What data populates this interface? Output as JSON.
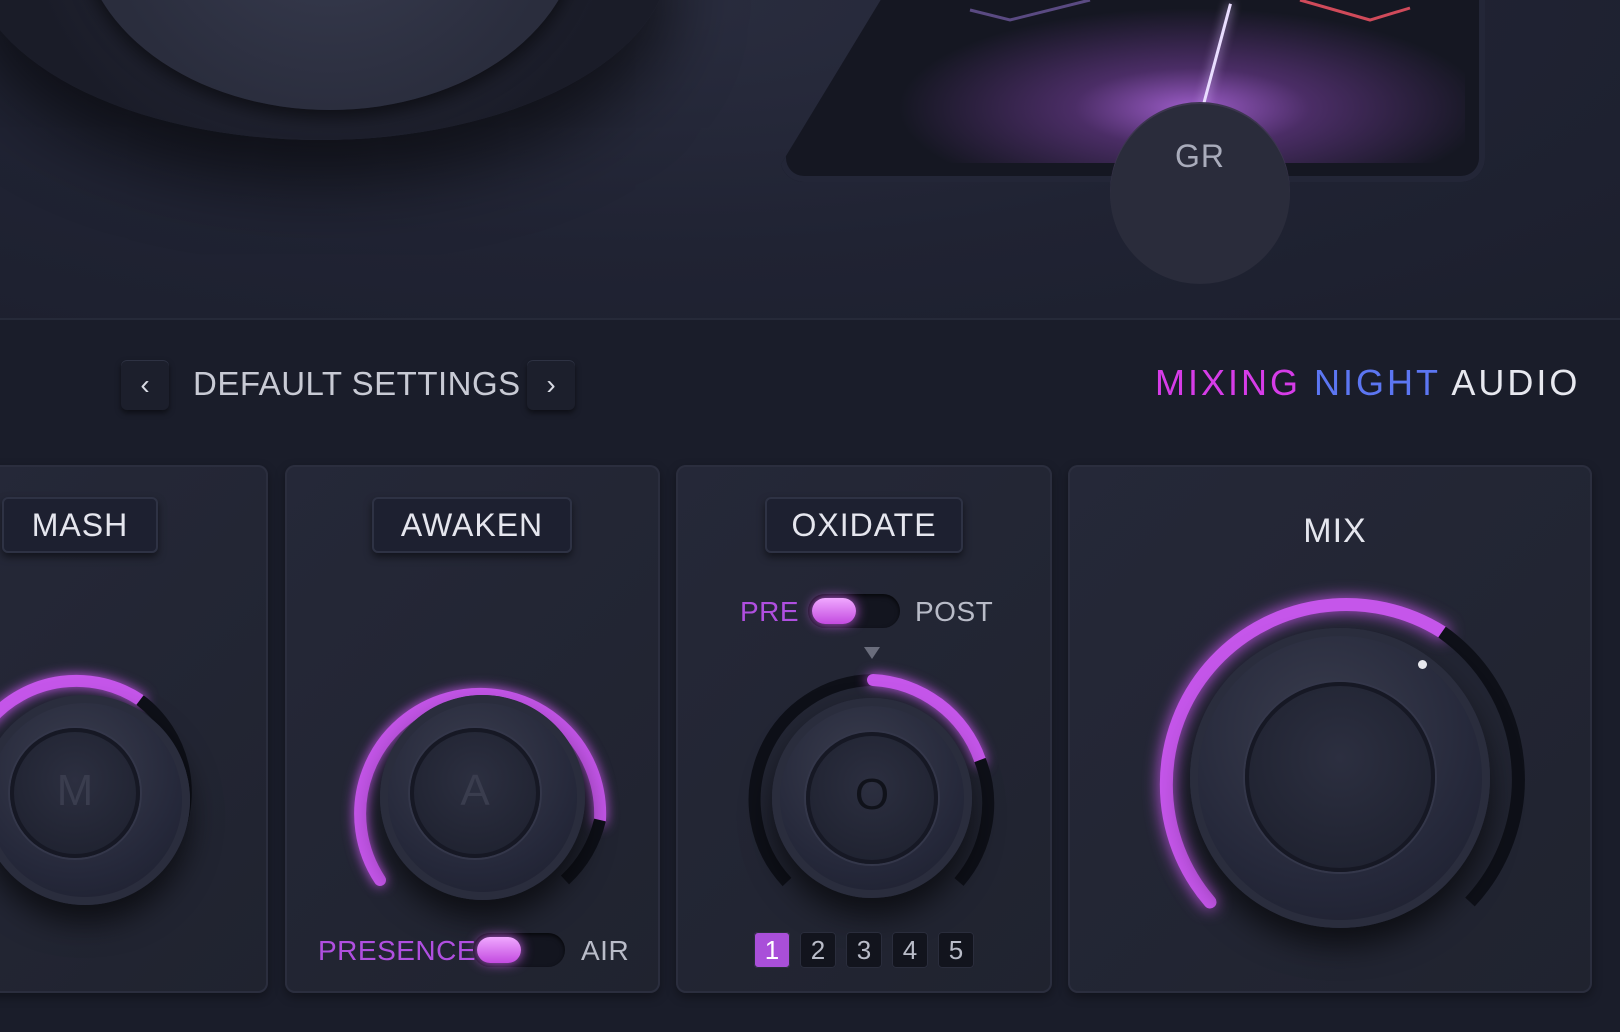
{
  "meter": {
    "label": "GR"
  },
  "preset": {
    "prev_icon": "chevron-left-icon",
    "name": "DEFAULT SETTINGS",
    "next_icon": "chevron-right-icon"
  },
  "brand": {
    "part1": "MIXING",
    "part2": "NIGHT",
    "part3": "AUDIO",
    "colors": {
      "part1": "#d63ce8",
      "part2": "#5c76f2",
      "part3": "#e7e8ef"
    }
  },
  "modules": {
    "mash": {
      "label": "MASH",
      "knob_letter": "M"
    },
    "awaken": {
      "label": "AWAKEN",
      "knob_letter": "A",
      "toggle_left": "PRESENCE",
      "toggle_right": "AIR",
      "toggle_state": "PRESENCE"
    },
    "oxidate": {
      "label": "OXIDATE",
      "knob_letter": "O",
      "toggle_left": "PRE",
      "toggle_right": "POST",
      "toggle_state": "PRE",
      "modes": [
        "1",
        "2",
        "3",
        "4",
        "5"
      ],
      "active_mode": "1"
    },
    "mix": {
      "label": "MIX"
    }
  },
  "accent_color": "#b04fe0"
}
